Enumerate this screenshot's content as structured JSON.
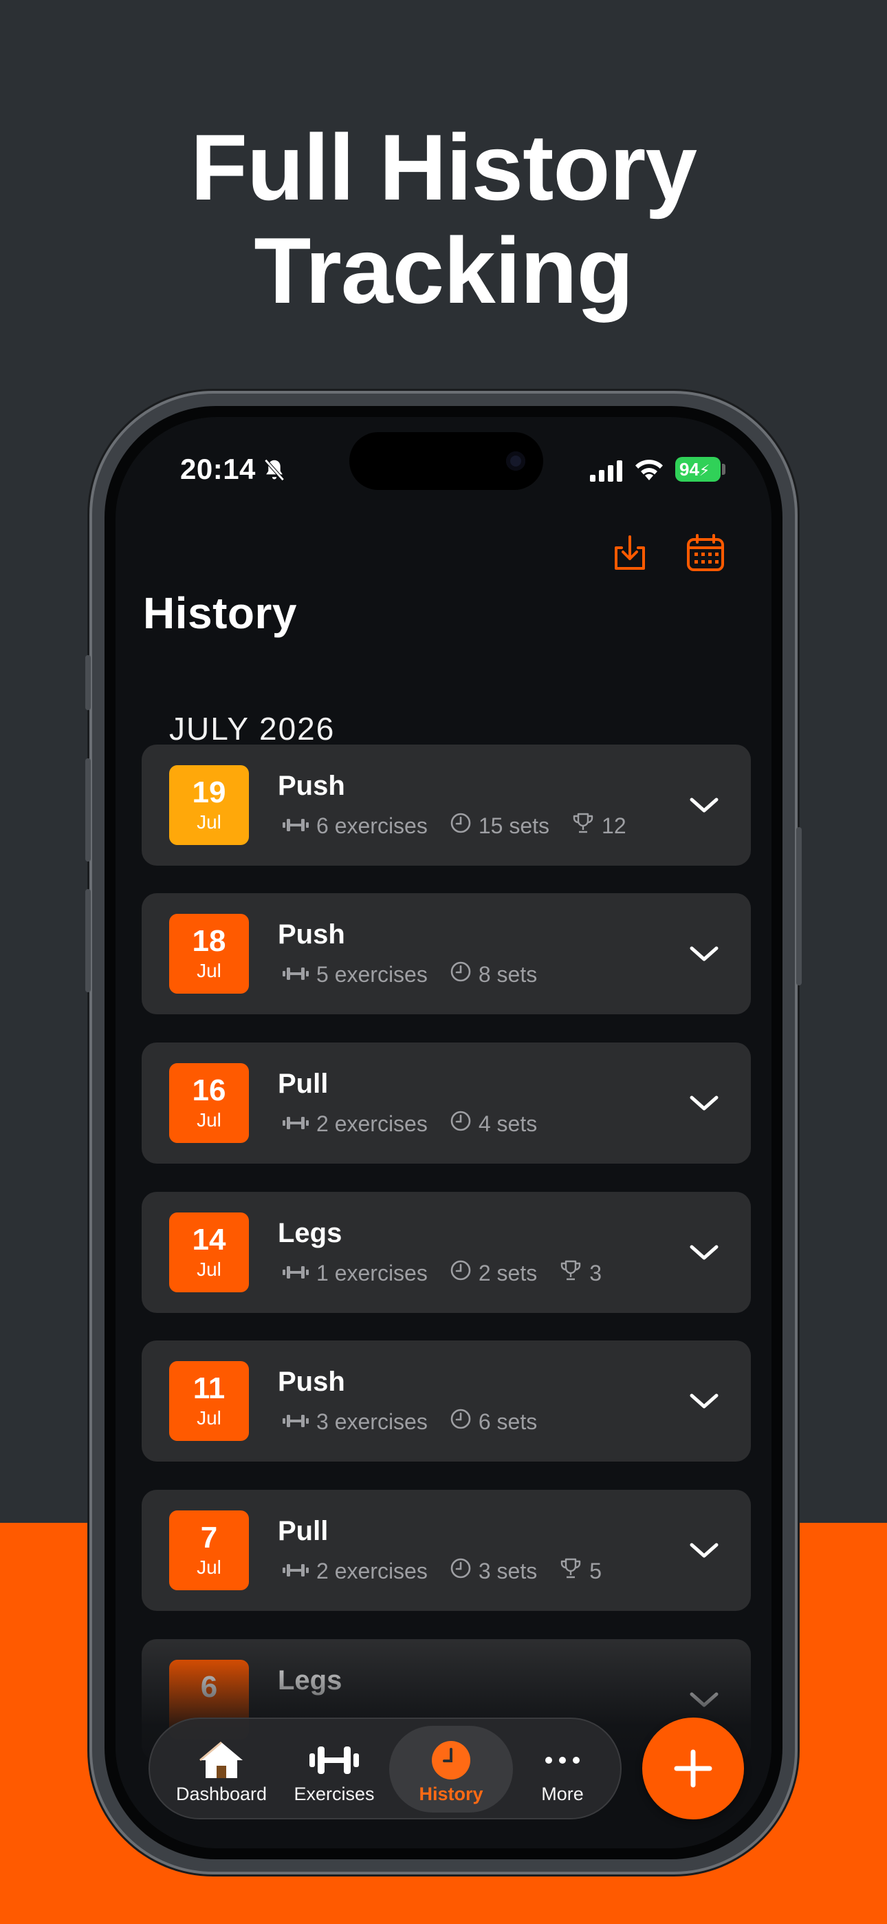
{
  "headline": {
    "line1": "Full History",
    "line2": "Tracking"
  },
  "status_bar": {
    "time": "20:14",
    "battery": "94"
  },
  "colors": {
    "accent": "#ff5a00",
    "today_highlight": "#ffa80a",
    "battery": "#30d158",
    "background": "#2c3034"
  },
  "header": {
    "title": "History",
    "export_icon": "download-icon",
    "calendar_icon": "calendar-icon"
  },
  "month_label": "JULY 2026",
  "workouts": [
    {
      "day": "19",
      "month": "Jul",
      "name": "Push",
      "exercises": "6 exercises",
      "sets": "15 sets",
      "prs": "12",
      "highlight": true
    },
    {
      "day": "18",
      "month": "Jul",
      "name": "Push",
      "exercises": "5 exercises",
      "sets": "8 sets",
      "prs": ""
    },
    {
      "day": "16",
      "month": "Jul",
      "name": "Pull",
      "exercises": "2 exercises",
      "sets": "4 sets",
      "prs": ""
    },
    {
      "day": "14",
      "month": "Jul",
      "name": "Legs",
      "exercises": "1 exercises",
      "sets": "2 sets",
      "prs": "3"
    },
    {
      "day": "11",
      "month": "Jul",
      "name": "Push",
      "exercises": "3 exercises",
      "sets": "6 sets",
      "prs": ""
    },
    {
      "day": "7",
      "month": "Jul",
      "name": "Pull",
      "exercises": "2 exercises",
      "sets": "3 sets",
      "prs": "5"
    },
    {
      "day": "6",
      "month": "",
      "name": "Legs",
      "exercises": "",
      "sets": "",
      "prs": ""
    }
  ],
  "tabbar": {
    "tabs": [
      {
        "label": "Dashboard",
        "icon": "home-icon"
      },
      {
        "label": "Exercises",
        "icon": "dumbbell-icon"
      },
      {
        "label": "History",
        "icon": "clock-icon",
        "active": true
      },
      {
        "label": "More",
        "icon": "ellipsis-icon"
      }
    ],
    "fab_icon": "plus-icon"
  }
}
